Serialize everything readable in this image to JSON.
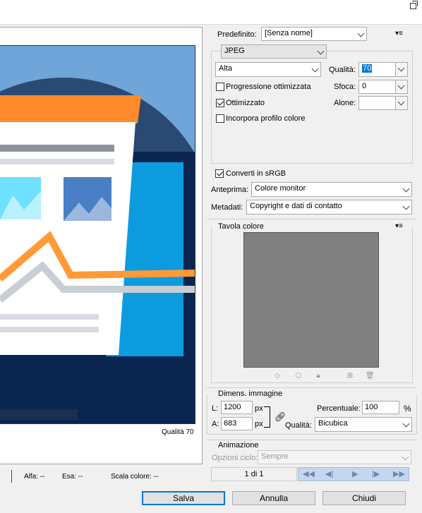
{
  "preset": {
    "label": "Predefinito:",
    "value": "[Senza nome]"
  },
  "format": {
    "value": "JPEG"
  },
  "compression": {
    "value": "Alta"
  },
  "quality": {
    "label": "Qualità:",
    "value": "70"
  },
  "progressive": {
    "label": "Progressione ottimizzata",
    "checked": false
  },
  "blur": {
    "label": "Sfoca:",
    "value": "0"
  },
  "optimized": {
    "label": "Ottimizzato",
    "checked": true
  },
  "matte": {
    "label": "Alone:",
    "value": ""
  },
  "embed_profile": {
    "label": "Incorpora profilo colore",
    "checked": false
  },
  "convert_srgb": {
    "label": "Converti in sRGB",
    "checked": true
  },
  "preview": {
    "label": "Anteprima:",
    "value": "Colore monitor"
  },
  "metadata": {
    "label": "Metadati:",
    "value": "Copyright e dati di contatto"
  },
  "color_table": {
    "title": "Tavola colore"
  },
  "image_size": {
    "title": "Dimens. immagine",
    "width_label": "L:",
    "width": "1200",
    "unit_w": "px",
    "height_label": "A:",
    "height": "683",
    "unit_h": "px",
    "percent_label": "Percentuale:",
    "percent": "100",
    "percent_unit": "%",
    "quality_label": "Qualità:",
    "quality": "Bicubica"
  },
  "animation": {
    "title": "Animazione",
    "loop_label": "Opzioni ciclo:",
    "loop_value": "Sempre",
    "frame_counter": "1 di 1"
  },
  "preview_panel": {
    "quality_note": "Qualità 70"
  },
  "status": {
    "alpha": "Alfa: --",
    "hex": "Esa: --",
    "index": "Scala colore: --"
  },
  "buttons": {
    "save": "Salva",
    "cancel": "Annulla",
    "close": "Chiudi"
  },
  "colors": {
    "accent": "#0078d7",
    "preview_bg": "#6fa5d9",
    "dark": "#1b2f4e"
  }
}
